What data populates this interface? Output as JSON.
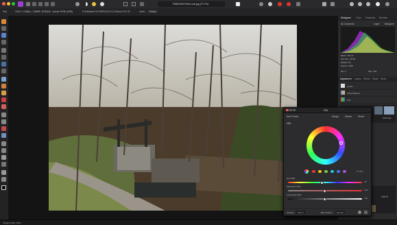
{
  "topbar": {
    "persona_label": "Affinity Photo",
    "doc_tab_label": "P3081253 Fleet Lock.jpg (72.7%)"
  },
  "context_bar": {
    "tool": "Pan",
    "doc_info": "1920 × 1536px, 1.88MP, RGBA/8 - Adobe RGB (1998)",
    "camera_info": "E-M1MarkII OLYMPUS M.12-100mm F4.0 IS",
    "units_label": "Units:",
    "units_value": "Pixels"
  },
  "right_panel": {
    "tabs": [
      "Histogram",
      "Color",
      "Swatches",
      "Brushes"
    ],
    "channel": "All Channels",
    "layer_option": "Layer",
    "marquee_option": "Marquee",
    "stats": [
      "Mean: 101.21",
      "Std. Dev.: 60.64",
      "Median: 97",
      "Pixels: 2.95M",
      "Min: 0",
      "Max: 255"
    ],
    "adj_tabs": [
      "Adjustment",
      "Layers",
      "Effects",
      "Styles",
      "Stock"
    ],
    "adjustments": [
      "Levels",
      "White Balance",
      "HSL"
    ],
    "thumb_labels": [
      "Shelf Age"
    ],
    "zoom": "100 %"
  },
  "hsl_dialog": {
    "title": "HSL",
    "buttons": [
      "Add Preset",
      "Merge",
      "Delete",
      "Reset"
    ],
    "section": "HSL",
    "picker_label": "Picker",
    "sliders": [
      {
        "label": "Hue Shift",
        "value": "-8°",
        "position": 0.45
      },
      {
        "label": "Saturation Shift",
        "value": "-1%",
        "position": 0.49
      },
      {
        "label": "Luminosity Shift",
        "value": "-1%",
        "position": 0.49
      }
    ],
    "opacity_label": "Opacity:",
    "opacity_value": "100 %",
    "blend_label": "Blend Mode:",
    "blend_value": "Normal",
    "color_dots": [
      "#e53935",
      "#f0c419",
      "#8bc34a",
      "#26c6da",
      "#3f7be0",
      "#b04de0",
      "#e040a0"
    ]
  },
  "status": {
    "hint": "Drag to pan view."
  }
}
